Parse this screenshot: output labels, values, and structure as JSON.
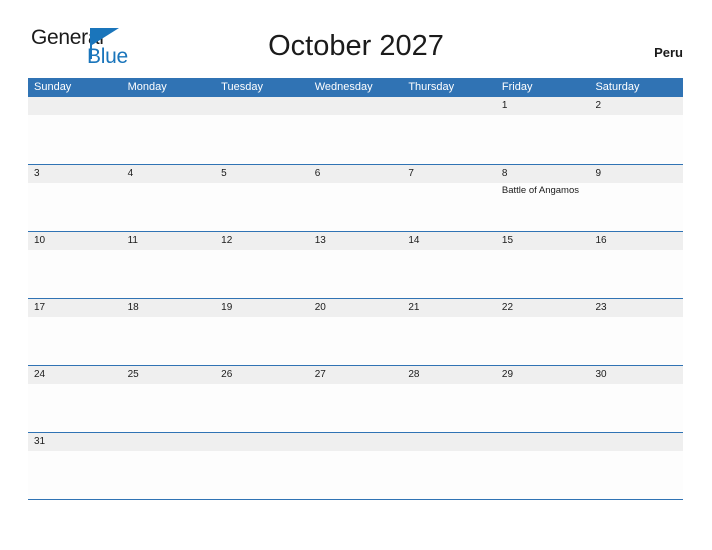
{
  "brand": {
    "name_part1": "General",
    "name_part2": "Blue",
    "flag_icon": "flag-triangle-icon",
    "accent_color": "#1a75bb"
  },
  "header": {
    "title": "October 2027",
    "country": "Peru"
  },
  "theme": {
    "header_blue": "#3073b4",
    "date_band_gray": "#efefef",
    "cell_white": "#fdfdfd",
    "text_dark": "#1b1b1b"
  },
  "calendar": {
    "month": "October",
    "year": "2027",
    "weekdays": [
      "Sunday",
      "Monday",
      "Tuesday",
      "Wednesday",
      "Thursday",
      "Friday",
      "Saturday"
    ],
    "weeks": [
      [
        {
          "date": "",
          "events": []
        },
        {
          "date": "",
          "events": []
        },
        {
          "date": "",
          "events": []
        },
        {
          "date": "",
          "events": []
        },
        {
          "date": "",
          "events": []
        },
        {
          "date": "1",
          "events": []
        },
        {
          "date": "2",
          "events": []
        }
      ],
      [
        {
          "date": "3",
          "events": []
        },
        {
          "date": "4",
          "events": []
        },
        {
          "date": "5",
          "events": []
        },
        {
          "date": "6",
          "events": []
        },
        {
          "date": "7",
          "events": []
        },
        {
          "date": "8",
          "events": [
            "Battle of Angamos"
          ]
        },
        {
          "date": "9",
          "events": []
        }
      ],
      [
        {
          "date": "10",
          "events": []
        },
        {
          "date": "11",
          "events": []
        },
        {
          "date": "12",
          "events": []
        },
        {
          "date": "13",
          "events": []
        },
        {
          "date": "14",
          "events": []
        },
        {
          "date": "15",
          "events": []
        },
        {
          "date": "16",
          "events": []
        }
      ],
      [
        {
          "date": "17",
          "events": []
        },
        {
          "date": "18",
          "events": []
        },
        {
          "date": "19",
          "events": []
        },
        {
          "date": "20",
          "events": []
        },
        {
          "date": "21",
          "events": []
        },
        {
          "date": "22",
          "events": []
        },
        {
          "date": "23",
          "events": []
        }
      ],
      [
        {
          "date": "24",
          "events": []
        },
        {
          "date": "25",
          "events": []
        },
        {
          "date": "26",
          "events": []
        },
        {
          "date": "27",
          "events": []
        },
        {
          "date": "28",
          "events": []
        },
        {
          "date": "29",
          "events": []
        },
        {
          "date": "30",
          "events": []
        }
      ],
      [
        {
          "date": "31",
          "events": []
        },
        {
          "date": "",
          "events": []
        },
        {
          "date": "",
          "events": []
        },
        {
          "date": "",
          "events": []
        },
        {
          "date": "",
          "events": []
        },
        {
          "date": "",
          "events": []
        },
        {
          "date": "",
          "events": []
        }
      ]
    ]
  }
}
